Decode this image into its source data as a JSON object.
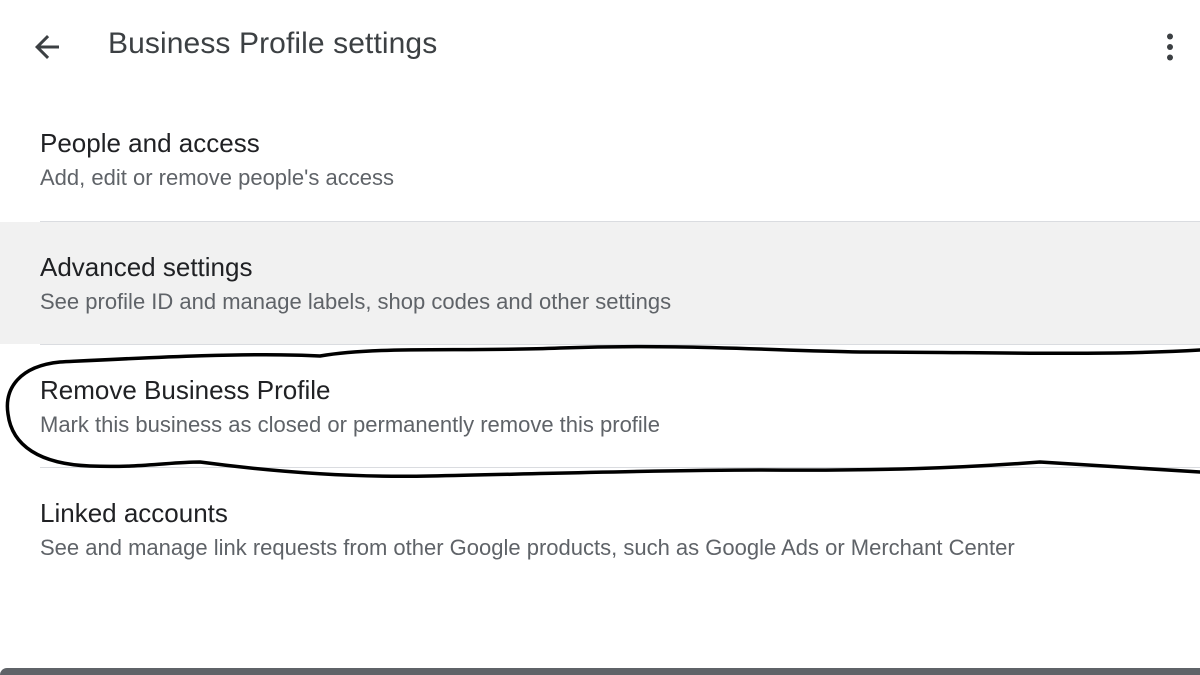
{
  "header": {
    "title": "Business Profile settings",
    "back_icon": "arrow-back-icon",
    "menu_icon": "more-vert-icon"
  },
  "items": [
    {
      "title": "People and access",
      "description": "Add, edit or remove people's access"
    },
    {
      "title": "Advanced settings",
      "description": "See profile ID and manage labels, shop codes and other settings",
      "highlighted": true
    },
    {
      "title": "Remove Business Profile",
      "description": "Mark this business as closed or permanently remove this profile",
      "annotation": "hand-drawn circle"
    },
    {
      "title": "Linked accounts",
      "description": "See and manage link requests from other Google products, such as Google Ads or Merchant Center"
    }
  ],
  "colors": {
    "title_text": "#3c4043",
    "primary_text": "#202124",
    "secondary_text": "#5f6368",
    "highlight_bg": "#f1f1f1",
    "divider": "#dadce0",
    "annotation_stroke": "#000000"
  }
}
